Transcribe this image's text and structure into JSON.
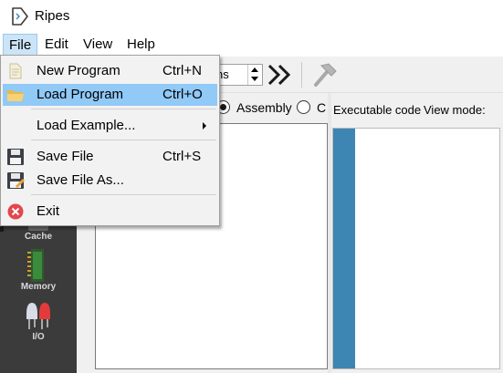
{
  "window": {
    "title": "Ripes",
    "app_icon": "ripes-logo-icon"
  },
  "menubar": {
    "items": [
      "File",
      "Edit",
      "View",
      "Help"
    ],
    "active": "File"
  },
  "toolbar": {
    "spinbox_value": "ns",
    "icons": [
      "fast-forward-icon",
      "hammer-icon"
    ]
  },
  "leftbar": {
    "items": [
      "Cache",
      "Memory",
      "I/O"
    ]
  },
  "editor": {
    "radio_options": [
      "Assembly",
      "C"
    ],
    "selected": "Assembly"
  },
  "right_panel": {
    "executable_label": "Executable code",
    "view_mode_label": "View mode:"
  },
  "file_menu": {
    "items": [
      {
        "label": "New Program",
        "shortcut": "Ctrl+N",
        "icon": "new-document-icon"
      },
      {
        "label": "Load Program",
        "shortcut": "Ctrl+O",
        "icon": "folder-icon",
        "highlighted": true
      },
      {
        "label": "Load Example...",
        "submenu": true
      },
      {
        "label": "Save File",
        "shortcut": "Ctrl+S",
        "icon": "floppy-disk-icon"
      },
      {
        "label": "Save File As...",
        "icon": "floppy-disk-edit-icon"
      },
      {
        "label": "Exit",
        "icon": "exit-icon"
      }
    ]
  },
  "colors": {
    "menu_highlight": "#91c9f7",
    "leftbar": "#3b3b3b",
    "exe_margin": "#3d85b3",
    "exit_red": "#e3474e"
  }
}
